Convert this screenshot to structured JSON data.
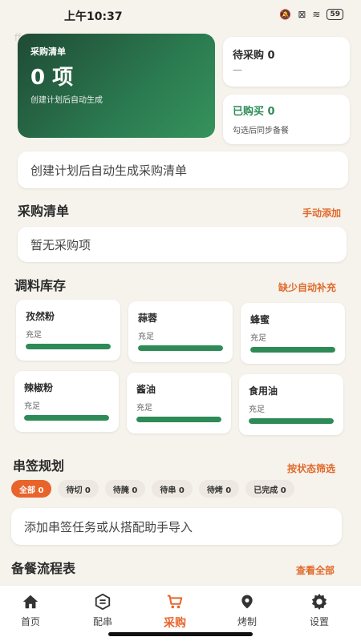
{
  "status_bar": {
    "time": "上午10:37",
    "battery": "59"
  },
  "watermark": "ffe0e5",
  "summary": {
    "title": "采购清单",
    "count": "0 项",
    "subtitle": "创建计划后自动生成",
    "pending_label": "待采购 0",
    "pending_value": "—",
    "bought_label": "已购买 0",
    "bought_sub": "勾选后同步备餐"
  },
  "banner": "创建计划后自动生成采购清单",
  "purchase": {
    "title": "采购清单",
    "action": "手动添加",
    "empty": "暂无采购项"
  },
  "inventory": {
    "title": "调料库存",
    "action": "缺少自动补充",
    "items": [
      {
        "name": "孜然粉",
        "status": "充足",
        "level": 1.0
      },
      {
        "name": "蒜蓉",
        "status": "充足",
        "level": 1.0
      },
      {
        "name": "蜂蜜",
        "status": "充足",
        "level": 1.0
      },
      {
        "name": "辣椒粉",
        "status": "充足",
        "level": 1.0
      },
      {
        "name": "酱油",
        "status": "充足",
        "level": 1.0
      },
      {
        "name": "食用油",
        "status": "充足",
        "level": 1.0
      }
    ]
  },
  "skewer_plan": {
    "title": "串签规划",
    "action": "按状态筛选",
    "filters": [
      {
        "label": "全部 0",
        "active": true
      },
      {
        "label": "待切 0",
        "active": false
      },
      {
        "label": "待腌 0",
        "active": false
      },
      {
        "label": "待串 0",
        "active": false
      },
      {
        "label": "待烤 0",
        "active": false
      },
      {
        "label": "已完成 0",
        "active": false
      }
    ],
    "add_prompt": "添加串签任务或从搭配助手导入"
  },
  "prep_flow": {
    "title": "备餐流程表",
    "action": "查看全部"
  },
  "tabs": [
    {
      "label": "首页",
      "icon": "home-icon",
      "active": false
    },
    {
      "label": "配串",
      "icon": "menu-icon",
      "active": false
    },
    {
      "label": "采购",
      "icon": "cart-icon",
      "active": true
    },
    {
      "label": "烤制",
      "icon": "location-icon",
      "active": false
    },
    {
      "label": "设置",
      "icon": "gear-icon",
      "active": false
    }
  ],
  "colors": {
    "accent": "#e8642b",
    "green": "#2e8b57",
    "hero_dark": "#1f4a35",
    "background": "#f6f2ec"
  }
}
